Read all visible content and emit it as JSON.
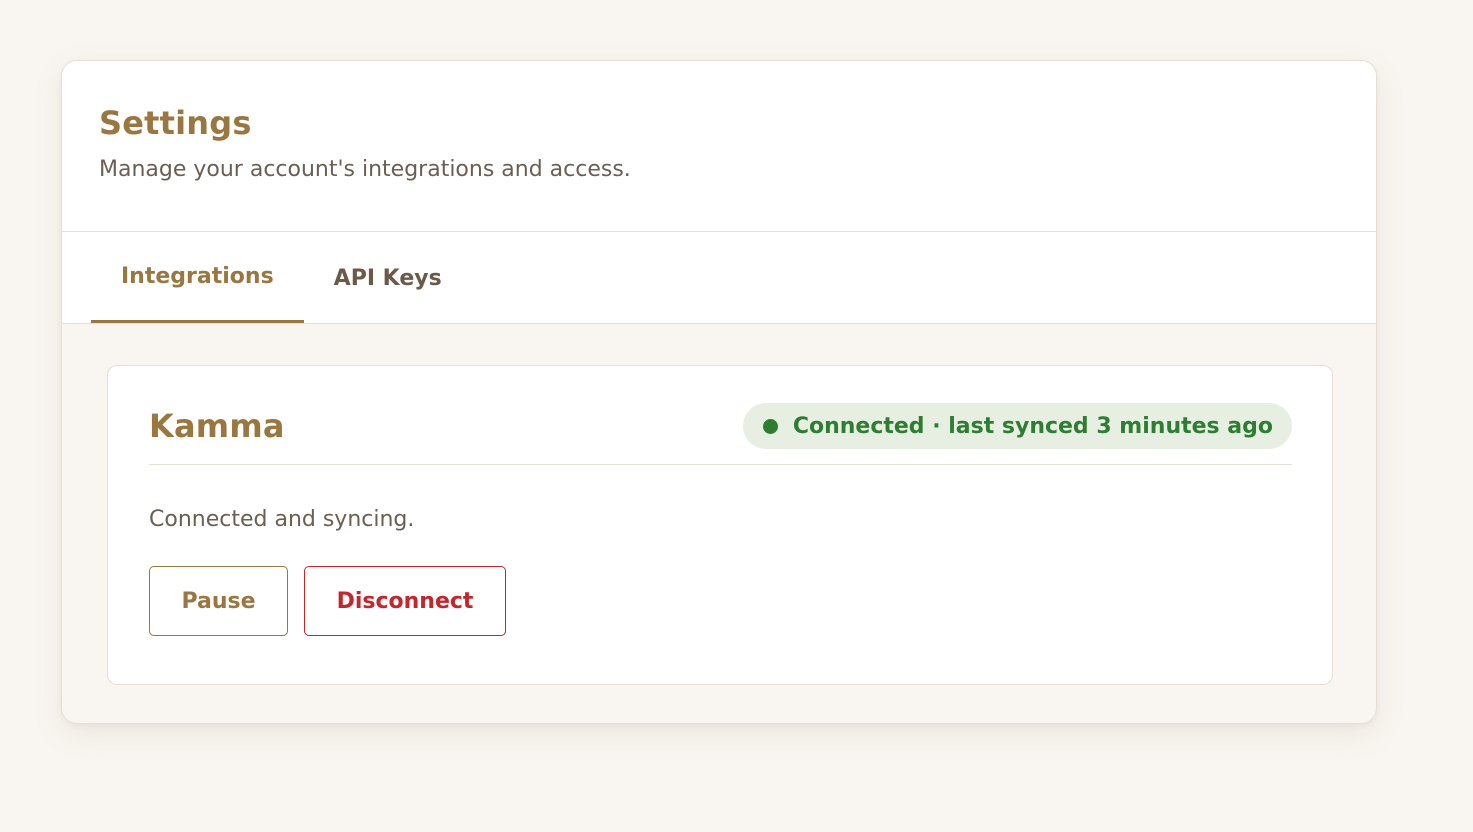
{
  "header": {
    "title": "Settings",
    "subtitle": "Manage your account's integrations and access."
  },
  "tabs": [
    {
      "label": "Integrations",
      "active": true
    },
    {
      "label": "API Keys",
      "active": false
    }
  ],
  "integration": {
    "name": "Kamma",
    "status_text": "Connected · last synced 3 minutes ago",
    "description": "Connected and syncing.",
    "pause_label": "Pause",
    "disconnect_label": "Disconnect"
  },
  "colors": {
    "accent": "#9a7741",
    "background": "#f9f6f1",
    "success": "#2f7d32",
    "success_bg": "#e6efe2",
    "danger": "#c1272d",
    "border": "#e6dfd3"
  },
  "icons": {
    "status": "status-dot-icon"
  }
}
